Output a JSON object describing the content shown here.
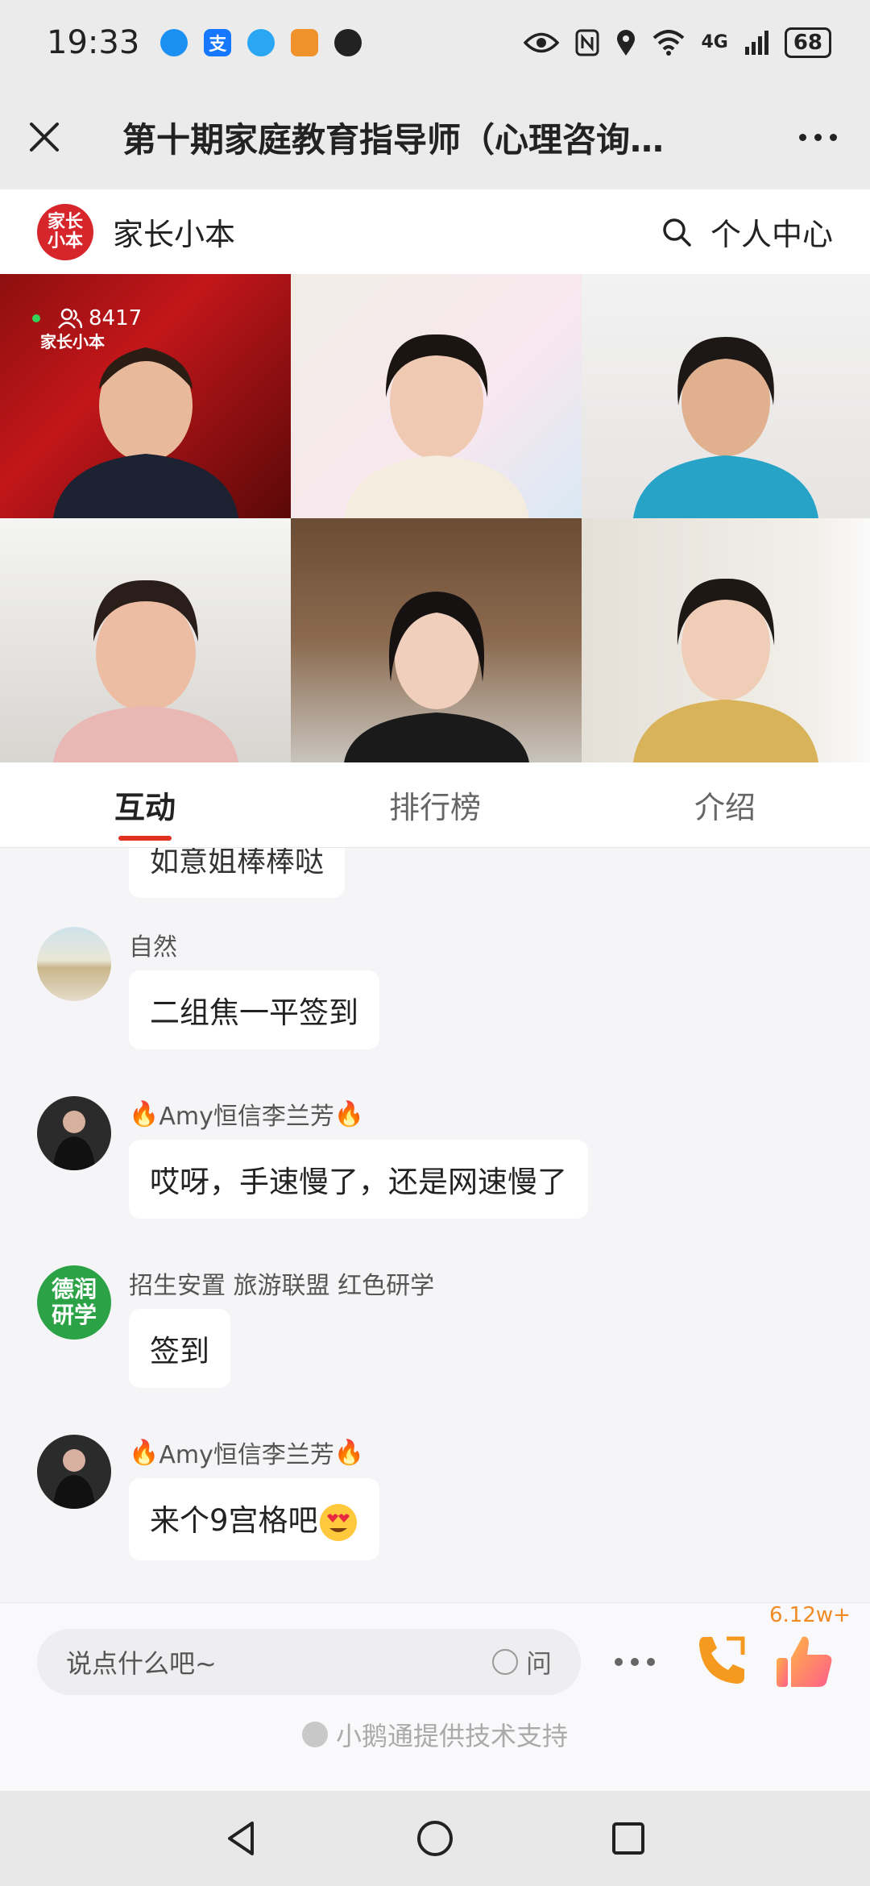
{
  "status_bar": {
    "time": "19:33",
    "network": "4G",
    "battery": "68",
    "app_icons": [
      "browser-icon",
      "alipay-icon",
      "message-icon",
      "shield-icon",
      "qq-icon"
    ]
  },
  "header": {
    "title": "第十期家庭教育指导师（心理咨询…"
  },
  "brand": {
    "logo_text": "家长小本",
    "name": "家长小本",
    "personal_center": "个人中心"
  },
  "live": {
    "viewer_count": "8417",
    "watermark": "家长小本"
  },
  "tabs": [
    {
      "label": "互动",
      "active": true
    },
    {
      "label": "排行榜",
      "active": false
    },
    {
      "label": "介绍",
      "active": false
    }
  ],
  "chat": {
    "partial_message": "如意姐棒棒哒",
    "messages": [
      {
        "name": "自然",
        "text": "二组焦一平签到",
        "flames": false
      },
      {
        "name": "Amy恒信李兰芳",
        "text": "哎呀，手速慢了，还是网速慢了",
        "flames": true
      },
      {
        "name": "招生安置 旅游联盟 红色研学",
        "text": "签到",
        "flames": false,
        "avatar_text": "德润研学"
      },
      {
        "name": "Amy恒信李兰芳",
        "text": "来个9宫格吧",
        "flames": true
      }
    ]
  },
  "input": {
    "placeholder": "说点什么吧~",
    "ask_label": "问",
    "like_count": "6.12w+"
  },
  "footer": {
    "powered_by": "小鹅通提供技术支持"
  },
  "colors": {
    "accent": "#e0301e",
    "brand_red": "#d6262c",
    "like_orange": "#f08a24"
  }
}
